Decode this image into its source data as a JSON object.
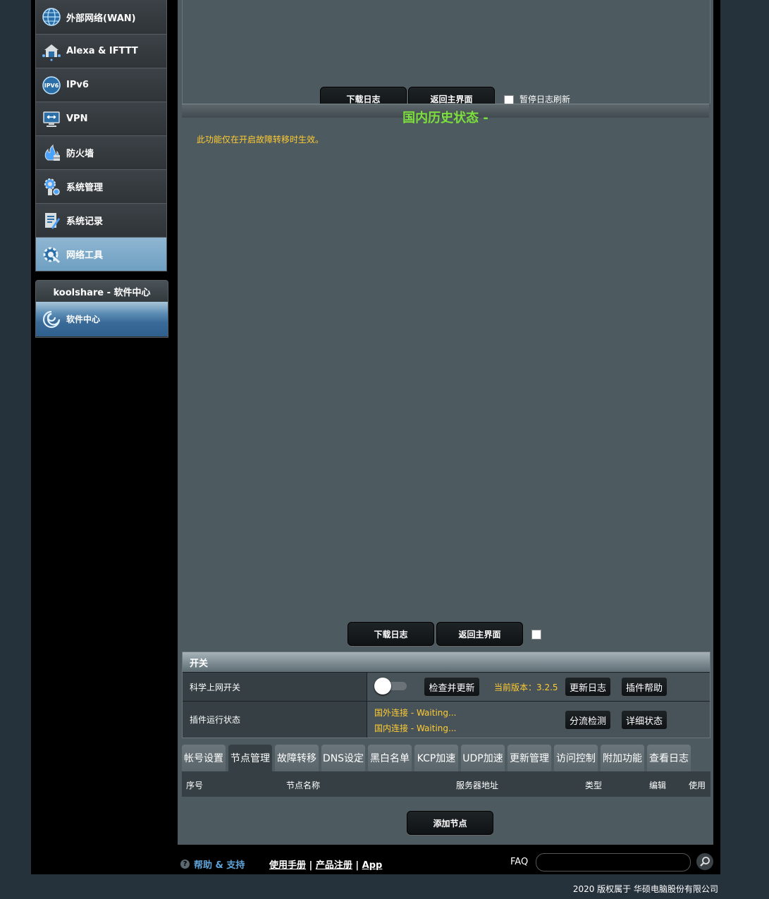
{
  "sidebar": {
    "items": [
      {
        "label": "外部网络(WAN)",
        "icon": "globe-icon"
      },
      {
        "label": "Alexa & IFTTT",
        "icon": "smart-home-icon"
      },
      {
        "label": "IPv6",
        "icon": "ipv6-icon"
      },
      {
        "label": "VPN",
        "icon": "vpn-icon"
      },
      {
        "label": "防火墙",
        "icon": "firewall-icon"
      },
      {
        "label": "系统管理",
        "icon": "system-admin-icon"
      },
      {
        "label": "系统记录",
        "icon": "system-log-icon"
      },
      {
        "label": "网络工具",
        "icon": "network-tools-icon"
      }
    ],
    "koolshare": {
      "title": "koolshare - 软件中心",
      "item": "软件中心"
    }
  },
  "top_controls": {
    "download_log": "下载日志",
    "back_main": "返回主界面",
    "pause_refresh": "暂停日志刷新"
  },
  "history": {
    "title": "国内历史状态 -",
    "notice": "此功能仅在开启故障转移时生效。"
  },
  "bottom_controls": {
    "download_log": "下载日志",
    "back_main": "返回主界面"
  },
  "switch_table": {
    "header": "开关",
    "row1": {
      "label": "科学上网开关",
      "check_update": "检查并更新",
      "version": "当前版本：3.2.5",
      "changelog": "更新日志",
      "help": "插件帮助"
    },
    "row2": {
      "label": "插件运行状态",
      "foreign": "国外连接 - Waiting...",
      "domestic": "国内连接 - Waiting...",
      "split_test": "分流检测",
      "detail": "详细状态"
    }
  },
  "tabs": [
    "帐号设置",
    "节点管理",
    "故障转移",
    "DNS设定",
    "黑白名单",
    "KCP加速",
    "UDP加速",
    "更新管理",
    "访问控制",
    "附加功能",
    "查看日志"
  ],
  "node_columns": [
    "序号",
    "节点名称",
    "服务器地址",
    "类型",
    "编辑",
    "使用"
  ],
  "add_node": "添加节点",
  "footer": {
    "help": "帮助 & 支持",
    "manual": "使用手册",
    "register": "产品注册",
    "app": "App",
    "sep": "|",
    "faq": "FAQ",
    "copyright": "2020 版权属于 华硕电脑股份有限公司"
  },
  "colors": {
    "accent_green": "#7cdf3c",
    "warning_yellow": "#ffcc33",
    "link_blue": "#5fa3d9"
  }
}
